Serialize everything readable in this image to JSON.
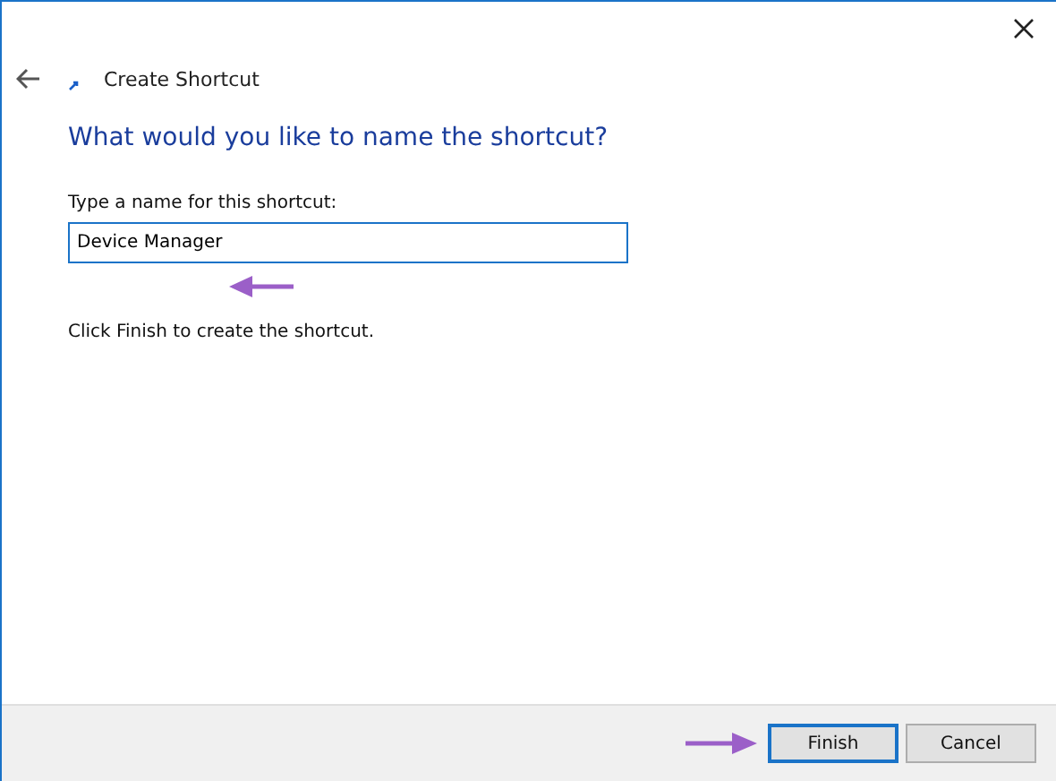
{
  "window": {
    "title": "Create Shortcut"
  },
  "heading": "What would you like to name the shortcut?",
  "name_field": {
    "label": "Type a name for this shortcut:",
    "value": "Device Manager"
  },
  "instruction": "Click Finish to create the shortcut.",
  "buttons": [
    {
      "label": "Finish",
      "selected": true
    },
    {
      "label": "Cancel",
      "selected": false
    }
  ]
}
